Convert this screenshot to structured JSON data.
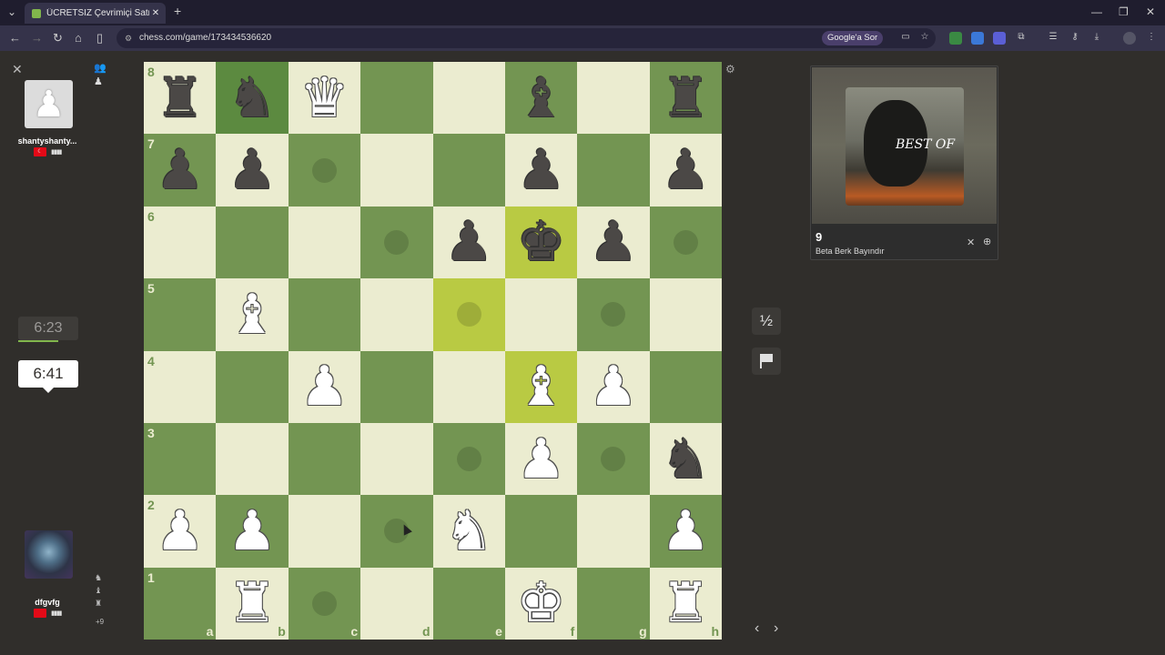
{
  "browser": {
    "tab_title": "ÜCRETSİZ Çevrimiçi Satranç Oy",
    "tab_close": "✕",
    "new_tab": "+",
    "url": "chess.com/game/173434536620",
    "google_button": "Google'a Sor",
    "window_controls": [
      "—",
      "❐",
      "✕"
    ]
  },
  "players": {
    "opponent": {
      "name": "shantyshanty...",
      "clock": "6:23"
    },
    "me": {
      "name": "dfgvfg",
      "clock": "6:41",
      "material_diff": "+9"
    }
  },
  "controls": {
    "close": "✕",
    "draw": "½",
    "prev": "‹",
    "next": "›"
  },
  "media": {
    "track": "9",
    "artist": "Beta Berk Bayındır",
    "album_text": "BEST OF",
    "close": "✕",
    "more": "⊕"
  },
  "board": {
    "files": [
      "a",
      "b",
      "c",
      "d",
      "e",
      "f",
      "g",
      "h"
    ],
    "ranks": [
      "8",
      "7",
      "6",
      "5",
      "4",
      "3",
      "2",
      "1"
    ],
    "position": [
      [
        "bR",
        "bN",
        "wQ",
        "",
        "",
        "bB",
        "",
        "bR"
      ],
      [
        "bP",
        "bP",
        "",
        "",
        "",
        "bP",
        "",
        "bP"
      ],
      [
        "",
        "",
        "",
        "",
        "bP",
        "bK",
        "bP",
        ""
      ],
      [
        "",
        "wB",
        "",
        "",
        "",
        "",
        "",
        ""
      ],
      [
        "",
        "",
        "wP",
        "",
        "",
        "wB",
        "wP",
        ""
      ],
      [
        "",
        "",
        "",
        "",
        "",
        "wP",
        "",
        "bN"
      ],
      [
        "wP",
        "wP",
        "",
        "",
        "wN",
        "",
        "",
        "wP"
      ],
      [
        "",
        "wR",
        "",
        "",
        "",
        "wK",
        "",
        "wR"
      ]
    ],
    "highlighted": [
      "f6",
      "e5",
      "f4"
    ],
    "selected": [
      "b8"
    ],
    "hints": [
      "c7",
      "d6",
      "h6",
      "e5",
      "g5",
      "e3",
      "g3",
      "d2",
      "c1"
    ]
  }
}
